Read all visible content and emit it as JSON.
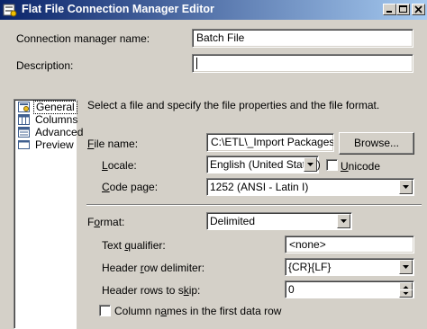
{
  "window": {
    "title": "Flat File Connection Manager Editor"
  },
  "connection_name": {
    "label": "Connection manager name:",
    "value": "Batch File"
  },
  "description": {
    "label": "Description:",
    "value": ""
  },
  "nav": {
    "items": [
      {
        "label": "General",
        "icon": "general-icon",
        "selected": true
      },
      {
        "label": "Columns",
        "icon": "columns-icon"
      },
      {
        "label": "Advanced",
        "icon": "advanced-icon"
      },
      {
        "label": "Preview",
        "icon": "preview-icon"
      }
    ]
  },
  "instructions": "Select a file and specify the file properties and the file format.",
  "file_name": {
    "label_u": "F",
    "label_rest": "ile name:",
    "value": "C:\\ETL\\_Import Packages.bat",
    "browse_label": "Browse..."
  },
  "locale": {
    "label_u": "L",
    "label_rest": "ocale:",
    "value": "English (United States)"
  },
  "unicode": {
    "label_u": "U",
    "label_rest": "nicode",
    "checked": false
  },
  "code_page": {
    "label_u": "C",
    "label_rest": "ode page:",
    "value": "1252  (ANSI - Latin I)"
  },
  "format": {
    "label_pre": "F",
    "label_u": "o",
    "label_rest": "rmat:",
    "value": "Delimited"
  },
  "text_qualifier": {
    "label_pre": "Text ",
    "label_u": "q",
    "label_rest": "ualifier:",
    "value": "<none>"
  },
  "header_row_delimiter": {
    "label_pre": "Header ",
    "label_u": "r",
    "label_rest": "ow delimiter:",
    "value": "{CR}{LF}"
  },
  "header_rows_skip": {
    "label_pre": "Header rows to s",
    "label_u": "k",
    "label_rest": "ip:",
    "value": "0"
  },
  "column_names": {
    "label_pre": "Column n",
    "label_u": "a",
    "label_rest": "mes in the first data row",
    "checked": false
  },
  "colors": {
    "title_bar_start": "#0a246a",
    "title_bar_end": "#a6caf0",
    "dialog_bg": "#d4d0c8"
  }
}
